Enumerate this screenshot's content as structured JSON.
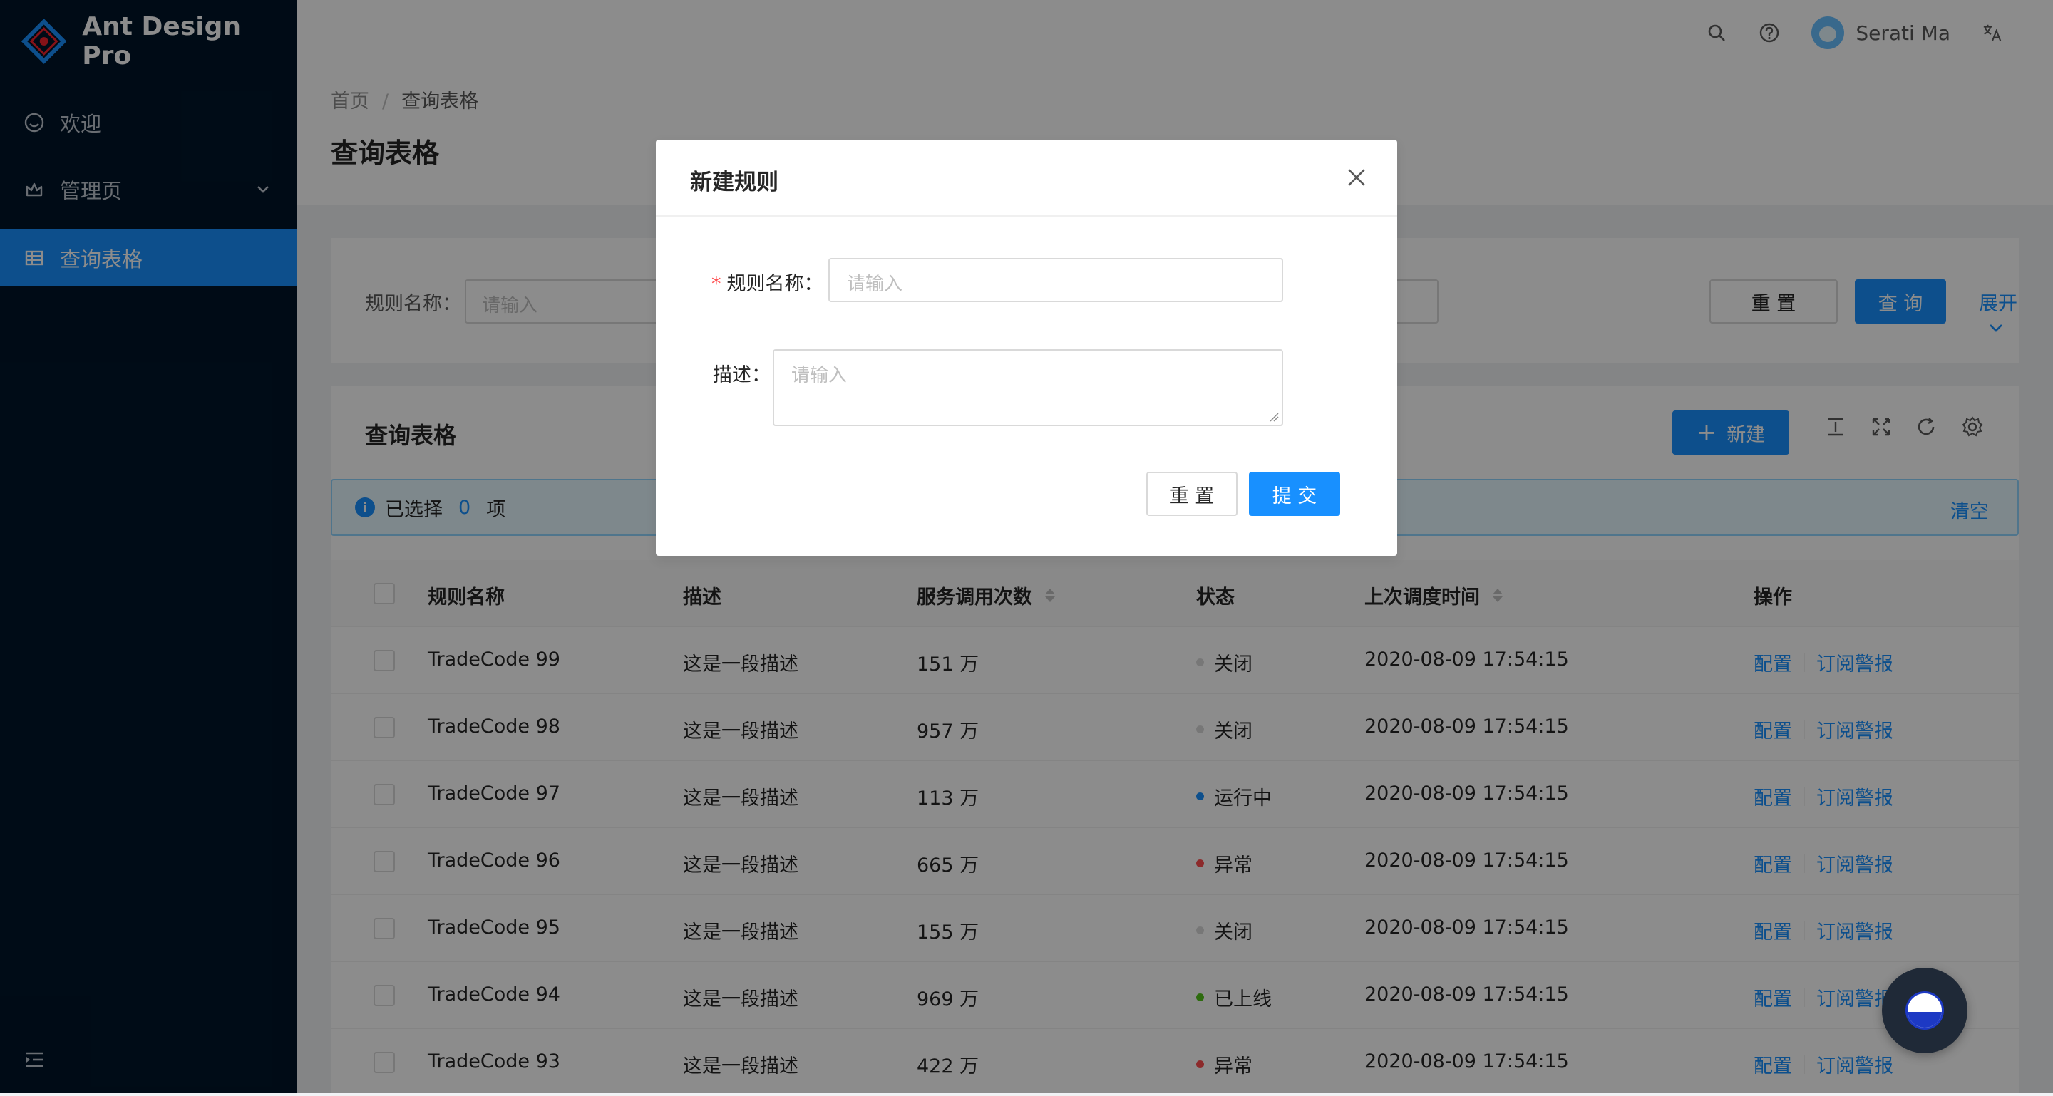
{
  "app": {
    "title": "Ant Design Pro"
  },
  "sidebar": {
    "items": [
      {
        "label": "欢迎",
        "icon": "smile-icon"
      },
      {
        "label": "管理页",
        "icon": "crown-icon"
      },
      {
        "label": "查询表格",
        "icon": "table-icon",
        "active": true
      }
    ]
  },
  "header": {
    "user_name": "Serati Ma"
  },
  "breadcrumb": {
    "home": "首页",
    "separator": "/",
    "current": "查询表格"
  },
  "page": {
    "title": "查询表格"
  },
  "search": {
    "rule_label": "规则名称：",
    "placeholder": "请输入",
    "reset": "重 置",
    "query": "查 询",
    "expand": "展开"
  },
  "table_card": {
    "title": "查询表格",
    "new_button": "新建",
    "alert": {
      "prefix": "已选择",
      "count": "0",
      "suffix": "项",
      "clear": "清空"
    },
    "columns": [
      "规则名称",
      "描述",
      "服务调用次数",
      "状态",
      "上次调度时间",
      "操作"
    ],
    "rows": [
      {
        "name": "TradeCode 99",
        "desc": "这是一段描述",
        "calls": "151 万",
        "status": "关闭",
        "time": "2020-08-09 17:54:15"
      },
      {
        "name": "TradeCode 98",
        "desc": "这是一段描述",
        "calls": "957 万",
        "status": "关闭",
        "time": "2020-08-09 17:54:15"
      },
      {
        "name": "TradeCode 97",
        "desc": "这是一段描述",
        "calls": "113 万",
        "status": "运行中",
        "time": "2020-08-09 17:54:15"
      },
      {
        "name": "TradeCode 96",
        "desc": "这是一段描述",
        "calls": "665 万",
        "status": "异常",
        "time": "2020-08-09 17:54:15"
      },
      {
        "name": "TradeCode 95",
        "desc": "这是一段描述",
        "calls": "155 万",
        "status": "关闭",
        "time": "2020-08-09 17:54:15"
      },
      {
        "name": "TradeCode 94",
        "desc": "这是一段描述",
        "calls": "969 万",
        "status": "已上线",
        "time": "2020-08-09 17:54:15"
      },
      {
        "name": "TradeCode 93",
        "desc": "这是一段描述",
        "calls": "422 万",
        "status": "异常",
        "time": "2020-08-09 17:54:15"
      }
    ],
    "ops": {
      "config": "配置",
      "subscribe": "订阅警报"
    }
  },
  "status_colors": {
    "关闭": "#d9d9d9",
    "运行中": "#1890ff",
    "异常": "#ff4d4f",
    "已上线": "#52c41a"
  },
  "modal": {
    "title": "新建规则",
    "name_label": "规则名称：",
    "desc_label": "描述：",
    "placeholder": "请输入",
    "reset": "重 置",
    "submit": "提 交"
  }
}
